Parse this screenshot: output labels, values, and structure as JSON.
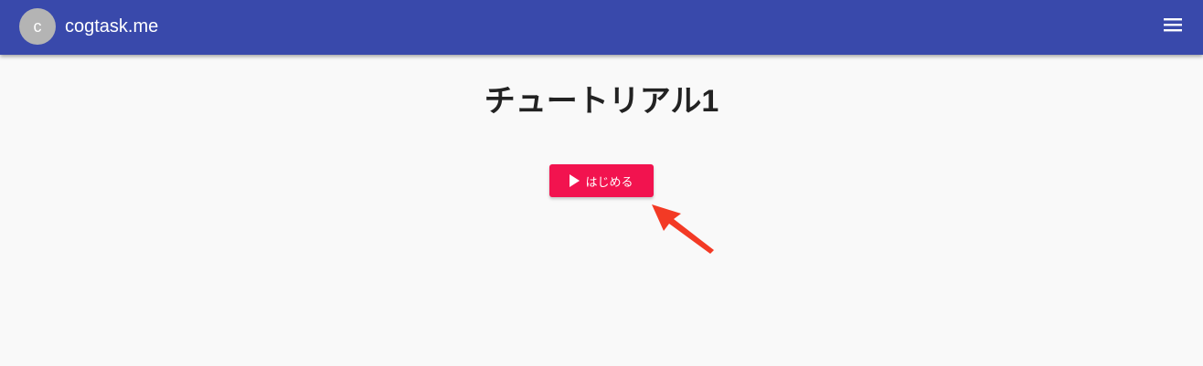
{
  "app": {
    "avatar_initial": "c",
    "brand": "cogtask.me",
    "menu_icon": "hamburger-menu-icon"
  },
  "main": {
    "title": "チュートリアル1",
    "start_button": {
      "label": "はじめる",
      "icon": "play-icon"
    }
  },
  "colors": {
    "topbar": "#3949ab",
    "avatar": "#b4b4b4",
    "start_button": "#f2134f",
    "annotation_arrow": "#f33a25",
    "background": "#f9f9f9"
  }
}
